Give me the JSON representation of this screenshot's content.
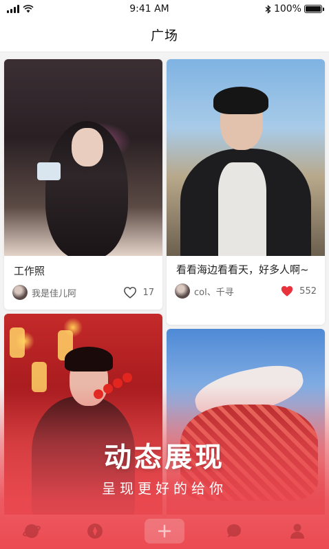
{
  "status_bar": {
    "time": "9:41 AM",
    "battery_text": "100%",
    "battery_level": 1.0
  },
  "nav": {
    "title": "广场"
  },
  "feed": [
    {
      "title": "工作照",
      "author": "我是佳儿阿",
      "likes": "17",
      "liked": false
    },
    {
      "title": "看看海边看看天，好多人啊~",
      "author": "col、千寻",
      "likes": "552",
      "liked": true
    },
    {},
    {}
  ],
  "promo": {
    "title": "动态展现",
    "subtitle": "呈现更好的给你"
  },
  "tab_bar": {
    "items": [
      "planet-icon",
      "compass-icon",
      "add-icon",
      "message-icon",
      "profile-icon"
    ]
  },
  "colors": {
    "accent": "#ec4a52",
    "like_active": "#e8323c"
  }
}
